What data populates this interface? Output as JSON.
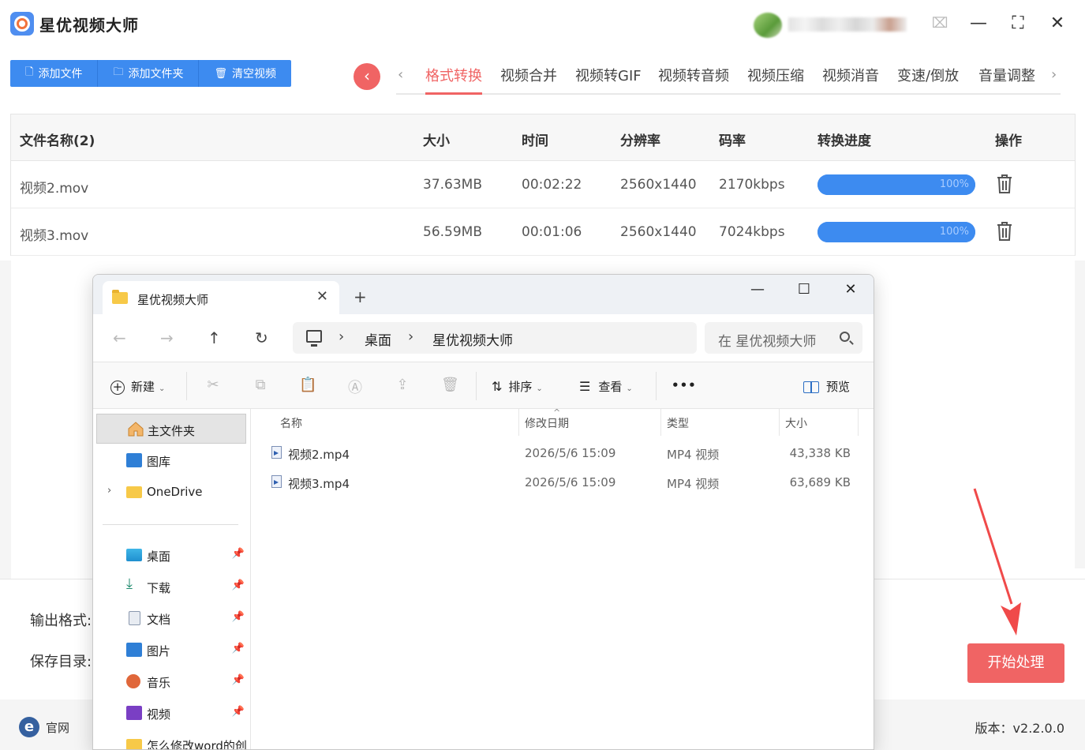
{
  "app": {
    "title": "星优视频大师",
    "window_controls": {
      "skin": "⌧",
      "minimize": "—",
      "maximize": "⛶",
      "close": "✕"
    }
  },
  "toolbar": {
    "add_file": "添加文件",
    "add_folder": "添加文件夹",
    "clear_videos": "清空视频"
  },
  "tabs": {
    "items": [
      "格式转换",
      "视频合并",
      "视频转GIF",
      "视频转音频",
      "视频压缩",
      "视频消音",
      "变速/倒放",
      "音量调整"
    ],
    "active": "格式转换",
    "prev_glyph": "‹",
    "next_glyph": "›",
    "collapse_glyph": "‹"
  },
  "table": {
    "headers": {
      "name": "文件名称(2)",
      "size": "大小",
      "time": "时间",
      "resolution": "分辨率",
      "bitrate": "码率",
      "progress": "转换进度",
      "action": "操作"
    },
    "rows": [
      {
        "name": "视频2.mov",
        "size": "37.63MB",
        "time": "00:02:22",
        "resolution": "2560x1440",
        "bitrate": "2170kbps",
        "progress": 100,
        "progress_label": "100%"
      },
      {
        "name": "视频3.mov",
        "size": "56.59MB",
        "time": "00:01:06",
        "resolution": "2560x1440",
        "bitrate": "7024kbps",
        "progress": 100,
        "progress_label": "100%"
      }
    ]
  },
  "bottom": {
    "output_format_label": "输出格式:",
    "save_dir_label": "保存目录:",
    "start_button": "开始处理",
    "site_label": "官网",
    "site_icon_glyph": "e",
    "version": "版本：v2.2.0.0"
  },
  "explorer": {
    "tab_title": "星优视频大师",
    "tab_close": "✕",
    "new_tab": "+",
    "window_controls": {
      "minimize": "—",
      "maximize": "☐",
      "close": "✕"
    },
    "nav": {
      "back": "←",
      "forward": "→",
      "up": "↑",
      "refresh": "↻"
    },
    "breadcrumb": [
      "桌面",
      "星优视频大师"
    ],
    "search_placeholder": "在 星优视频大师",
    "commands": {
      "new": "新建",
      "sort": "排序",
      "view": "查看",
      "more": "•••",
      "preview": "预览"
    },
    "sidebar": [
      {
        "label": "主文件夹",
        "icon": "home-icon",
        "selected": true
      },
      {
        "label": "图库",
        "icon": "gallery-icon"
      },
      {
        "label": "OneDrive",
        "icon": "folder-icon",
        "expandable": true
      },
      {
        "label": "桌面",
        "icon": "desktop-icon",
        "pinned": true
      },
      {
        "label": "下载",
        "icon": "download-icon",
        "pinned": true
      },
      {
        "label": "文档",
        "icon": "document-icon",
        "pinned": true
      },
      {
        "label": "图片",
        "icon": "pictures-icon",
        "pinned": true
      },
      {
        "label": "音乐",
        "icon": "music-icon",
        "pinned": true
      },
      {
        "label": "视频",
        "icon": "videos-icon",
        "pinned": true
      },
      {
        "label": "怎么修改word的创",
        "icon": "folder-icon"
      }
    ],
    "columns": {
      "name": "名称",
      "modified": "修改日期",
      "type": "类型",
      "size": "大小"
    },
    "files": [
      {
        "name": "视频2.mp4",
        "modified": "2026/5/6 15:09",
        "type": "MP4 视频",
        "size": "43,338 KB"
      },
      {
        "name": "视频3.mp4",
        "modified": "2026/5/6 15:09",
        "type": "MP4 视频",
        "size": "63,689 KB"
      }
    ]
  },
  "colors": {
    "accent_blue": "#3d8bf0",
    "accent_red": "#f06464",
    "arrow_red": "#f04a4a"
  }
}
